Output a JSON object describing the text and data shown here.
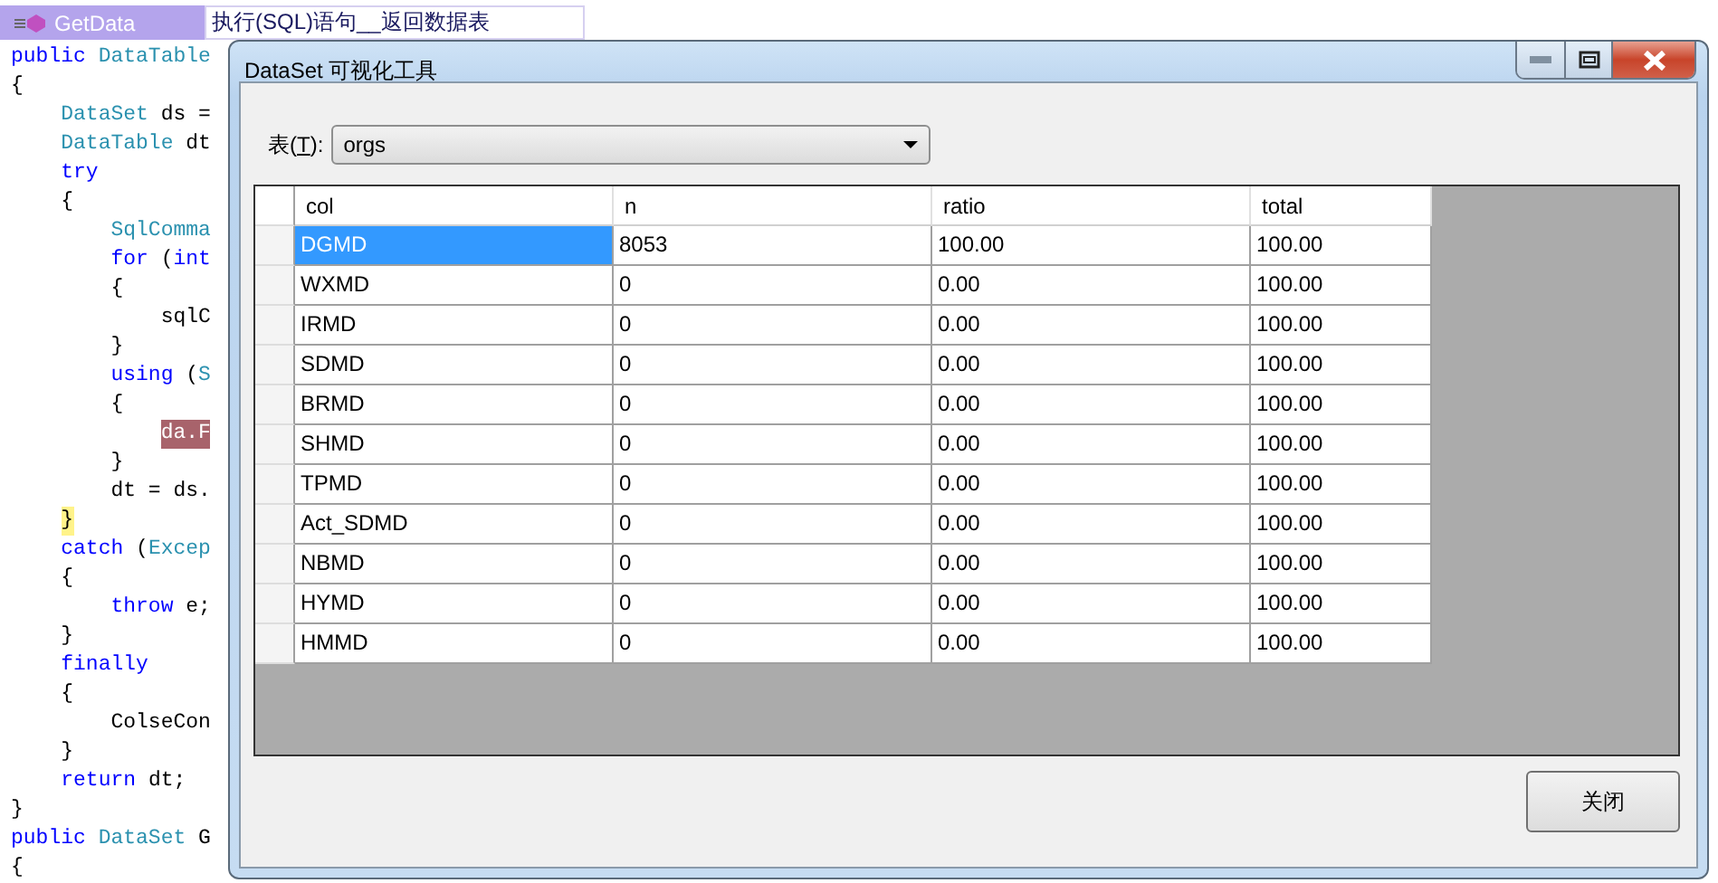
{
  "editor": {
    "member_dropdown": "GetData",
    "description_dropdown": "执行(SQL)语句__返回数据表",
    "lines": [
      [
        {
          "text": "public ",
          "kind": "keyword"
        },
        {
          "text": "DataTable",
          "kind": "type"
        }
      ],
      [
        {
          "text": "{",
          "kind": "plain"
        }
      ],
      [
        {
          "text": "    DataSet",
          "kind": "type"
        },
        {
          "text": " ds =",
          "kind": "plain"
        }
      ],
      [
        {
          "text": "    DataTable",
          "kind": "type"
        },
        {
          "text": " dt",
          "kind": "plain"
        }
      ],
      [
        {
          "text": "    try",
          "kind": "keyword"
        }
      ],
      [
        {
          "text": "    {",
          "kind": "plain"
        }
      ],
      [
        {
          "text": "        SqlComma",
          "kind": "type"
        }
      ],
      [
        {
          "text": "        for",
          "kind": "keyword"
        },
        {
          "text": " (",
          "kind": "plain"
        },
        {
          "text": "int",
          "kind": "keyword"
        }
      ],
      [
        {
          "text": "        {",
          "kind": "plain"
        }
      ],
      [
        {
          "text": "            sqlC",
          "kind": "plain"
        }
      ],
      [
        {
          "text": "        }",
          "kind": "plain"
        }
      ],
      [
        {
          "text": "        using",
          "kind": "keyword"
        },
        {
          "text": " (",
          "kind": "plain"
        },
        {
          "text": "S",
          "kind": "type"
        }
      ],
      [
        {
          "text": "        {",
          "kind": "plain"
        }
      ],
      [
        {
          "text": "            da.F",
          "kind": "highlight"
        }
      ],
      [
        {
          "text": "        }",
          "kind": "plain"
        }
      ],
      [
        {
          "text": "        dt = ds.",
          "kind": "plain"
        }
      ],
      [
        {
          "text": "    }",
          "kind": "match"
        }
      ],
      [
        {
          "text": "    catch",
          "kind": "keyword"
        },
        {
          "text": " (",
          "kind": "plain"
        },
        {
          "text": "Excep",
          "kind": "type"
        }
      ],
      [
        {
          "text": "    {",
          "kind": "plain"
        }
      ],
      [
        {
          "text": "        throw",
          "kind": "keyword"
        },
        {
          "text": " e;",
          "kind": "plain"
        }
      ],
      [
        {
          "text": "    }",
          "kind": "plain"
        }
      ],
      [
        {
          "text": "    finally",
          "kind": "keyword"
        }
      ],
      [
        {
          "text": "    {",
          "kind": "plain"
        }
      ],
      [
        {
          "text": "        ColseCon",
          "kind": "plain"
        }
      ],
      [
        {
          "text": "    }",
          "kind": "plain"
        }
      ],
      [
        {
          "text": "    return",
          "kind": "keyword"
        },
        {
          "text": " dt;",
          "kind": "plain"
        }
      ],
      [
        {
          "text": "}",
          "kind": "plain"
        }
      ],
      [
        {
          "text": "public ",
          "kind": "keyword"
        },
        {
          "text": "DataSet",
          "kind": "type"
        },
        {
          "text": " G",
          "kind": "plain"
        }
      ],
      [
        {
          "text": "{",
          "kind": "plain"
        }
      ]
    ]
  },
  "dialog": {
    "title": "DataSet 可视化工具",
    "table_label": [
      "表(",
      "T",
      "):"
    ],
    "table_select": "orgs",
    "grid": {
      "columns": [
        "col",
        "n",
        "ratio",
        "total"
      ],
      "rows": [
        {
          "selected": true,
          "cells": [
            "DGMD",
            "8053",
            "100.00",
            "100.00"
          ]
        },
        {
          "selected": false,
          "cells": [
            "WXMD",
            "0",
            "0.00",
            "100.00"
          ]
        },
        {
          "selected": false,
          "cells": [
            "IRMD",
            "0",
            "0.00",
            "100.00"
          ]
        },
        {
          "selected": false,
          "cells": [
            "SDMD",
            "0",
            "0.00",
            "100.00"
          ]
        },
        {
          "selected": false,
          "cells": [
            "BRMD",
            "0",
            "0.00",
            "100.00"
          ]
        },
        {
          "selected": false,
          "cells": [
            "SHMD",
            "0",
            "0.00",
            "100.00"
          ]
        },
        {
          "selected": false,
          "cells": [
            "TPMD",
            "0",
            "0.00",
            "100.00"
          ]
        },
        {
          "selected": false,
          "cells": [
            "Act_SDMD",
            "0",
            "0.00",
            "100.00"
          ]
        },
        {
          "selected": false,
          "cells": [
            "NBMD",
            "0",
            "0.00",
            "100.00"
          ]
        },
        {
          "selected": false,
          "cells": [
            "HYMD",
            "0",
            "0.00",
            "100.00"
          ]
        },
        {
          "selected": false,
          "cells": [
            "HMMD",
            "0",
            "0.00",
            "100.00"
          ]
        }
      ]
    },
    "close_button": "关闭"
  }
}
